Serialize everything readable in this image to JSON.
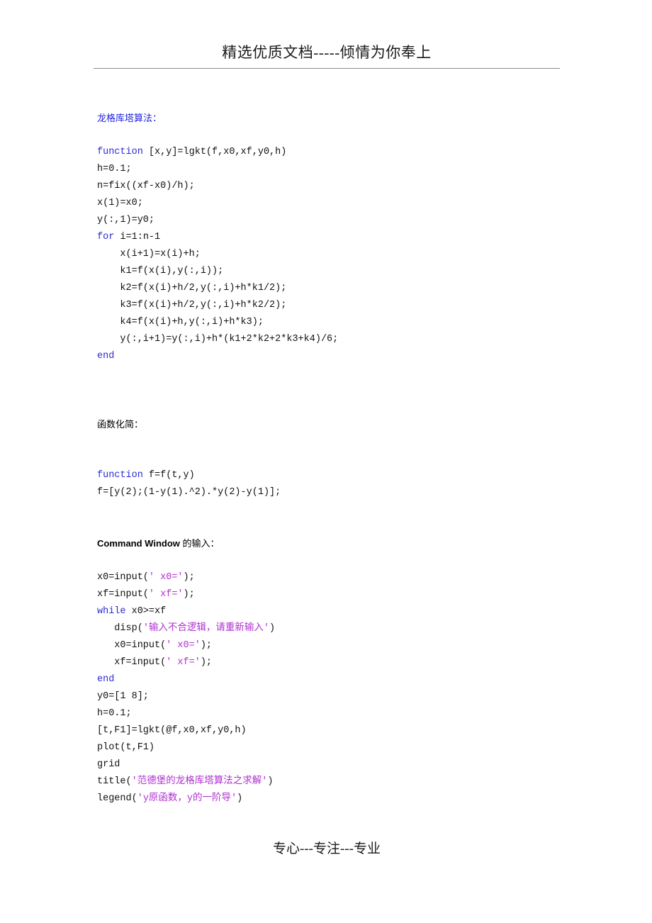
{
  "document": {
    "header_text": "精选优质文档-----倾情为你奉上",
    "footer_text": "专心---专注---专业"
  },
  "colors": {
    "keyword_blue": "#2b2bd6",
    "heading_blue": "#2222dd",
    "string_magenta": "#b030d0",
    "code_black": "#111111",
    "rule_gray": "#8a8a8a"
  },
  "sections": {
    "runge_kutta": {
      "heading": "龙格库塔算法："
    },
    "function_simplify": {
      "heading": "函数化简："
    },
    "command_window": {
      "heading_latin": "Command Window ",
      "heading_cn": "的输入："
    }
  },
  "code": {
    "lgkt": [
      [
        {
          "t": "function",
          "c": "kw"
        },
        {
          "t": " [x,y]=lgkt(f,x0,xf,y0,h)",
          "c": "plain"
        }
      ],
      [
        {
          "t": "h=0.1;",
          "c": "plain"
        }
      ],
      [
        {
          "t": "n=fix((xf-x0)/h);",
          "c": "plain"
        }
      ],
      [
        {
          "t": "x(1)=x0;",
          "c": "plain"
        }
      ],
      [
        {
          "t": "y(:,1)=y0;",
          "c": "plain"
        }
      ],
      [
        {
          "t": "for",
          "c": "kw"
        },
        {
          "t": " i=1:n-1",
          "c": "plain"
        }
      ],
      [
        {
          "t": "    x(i+1)=x(i)+h;",
          "c": "plain"
        }
      ],
      [
        {
          "t": "    k1=f(x(i),y(:,i));",
          "c": "plain"
        }
      ],
      [
        {
          "t": "    k2=f(x(i)+h/2,y(:,i)+h*k1/2);",
          "c": "plain"
        }
      ],
      [
        {
          "t": "    k3=f(x(i)+h/2,y(:,i)+h*k2/2);",
          "c": "plain"
        }
      ],
      [
        {
          "t": "    k4=f(x(i)+h,y(:,i)+h*k3);",
          "c": "plain"
        }
      ],
      [
        {
          "t": "    y(:,i+1)=y(:,i)+h*(k1+2*k2+2*k3+k4)/6;",
          "c": "plain"
        }
      ],
      [
        {
          "t": "end",
          "c": "kw"
        }
      ]
    ],
    "ffunc": [
      [
        {
          "t": "function",
          "c": "kw"
        },
        {
          "t": " f=f(t,y)",
          "c": "plain"
        }
      ],
      [
        {
          "t": "f=[y(2);(1-y(1).^2).*y(2)-y(1)];",
          "c": "plain"
        }
      ]
    ],
    "command": [
      [
        {
          "t": "x0=input(",
          "c": "plain"
        },
        {
          "t": "' x0='",
          "c": "str"
        },
        {
          "t": ");",
          "c": "plain"
        }
      ],
      [
        {
          "t": "xf=input(",
          "c": "plain"
        },
        {
          "t": "' xf='",
          "c": "str"
        },
        {
          "t": ");",
          "c": "plain"
        }
      ],
      [
        {
          "t": "while",
          "c": "kw"
        },
        {
          "t": " x0>=xf",
          "c": "plain"
        }
      ],
      [
        {
          "t": "   disp(",
          "c": "plain"
        },
        {
          "t": "'输入不合逻辑，请重新输入'",
          "c": "str"
        },
        {
          "t": ")",
          "c": "plain"
        }
      ],
      [
        {
          "t": "   x0=input(",
          "c": "plain"
        },
        {
          "t": "' x0='",
          "c": "str"
        },
        {
          "t": ");",
          "c": "plain"
        }
      ],
      [
        {
          "t": "   xf=input(",
          "c": "plain"
        },
        {
          "t": "' xf='",
          "c": "str"
        },
        {
          "t": ");",
          "c": "plain"
        }
      ],
      [
        {
          "t": "end",
          "c": "kw"
        }
      ],
      [
        {
          "t": "y0=[1 8];",
          "c": "plain"
        }
      ],
      [
        {
          "t": "h=0.1;",
          "c": "plain"
        }
      ],
      [
        {
          "t": "[t,F1]=lgkt(@f,x0,xf,y0,h)",
          "c": "plain"
        }
      ],
      [
        {
          "t": "plot(t,F1)",
          "c": "plain"
        }
      ],
      [
        {
          "t": "grid",
          "c": "plain"
        }
      ],
      [
        {
          "t": "title(",
          "c": "plain"
        },
        {
          "t": "'范德堡的龙格库塔算法之求解'",
          "c": "str"
        },
        {
          "t": ")",
          "c": "plain"
        }
      ],
      [
        {
          "t": "legend(",
          "c": "plain"
        },
        {
          "t": "'y原函数，y的一阶导'",
          "c": "str"
        },
        {
          "t": ")",
          "c": "plain"
        }
      ]
    ]
  }
}
